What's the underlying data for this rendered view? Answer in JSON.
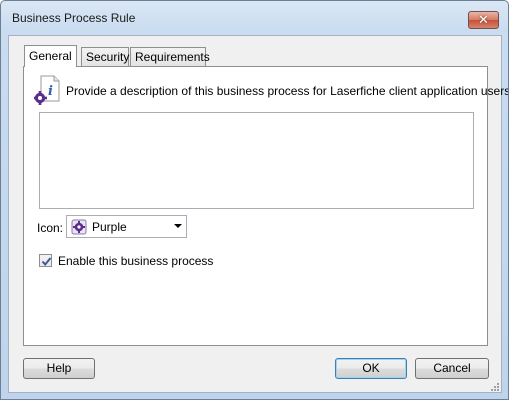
{
  "window": {
    "title": "Business Process Rule",
    "close_label": "✕"
  },
  "tabs": [
    {
      "label": "General"
    },
    {
      "label": "Security"
    },
    {
      "label": "Requirements"
    }
  ],
  "general": {
    "description_prompt": "Provide a description of this business process for Laserfiche client application users.",
    "description_value": "",
    "icon_label": "Icon:",
    "icon_selected": "Purple",
    "enable_label": "Enable this business process",
    "enable_checked": true
  },
  "buttons": {
    "help": "Help",
    "ok": "OK",
    "cancel": "Cancel"
  },
  "colors": {
    "icon_purple": "#5b2d8f",
    "info_blue": "#2f5fb0"
  }
}
